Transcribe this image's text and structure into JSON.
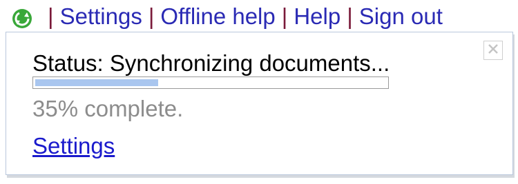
{
  "topbar": {
    "sync_icon": "sync-check-icon",
    "separator": "|",
    "links": [
      {
        "label": "Settings"
      },
      {
        "label": "Offline help"
      },
      {
        "label": "Help"
      },
      {
        "label": "Sign out"
      }
    ]
  },
  "popup": {
    "status_text": "Status: Synchronizing documents...",
    "progress_fraction": 0.35,
    "percent_text": "35% complete.",
    "settings_label": "Settings",
    "close_icon": "close-icon"
  },
  "colors": {
    "link": "#2a2ab4",
    "separator": "#7a1a3a",
    "progress_fill": "#a9c6ef",
    "icon_green": "#3aa83a",
    "muted_text": "#8c8c8c"
  }
}
